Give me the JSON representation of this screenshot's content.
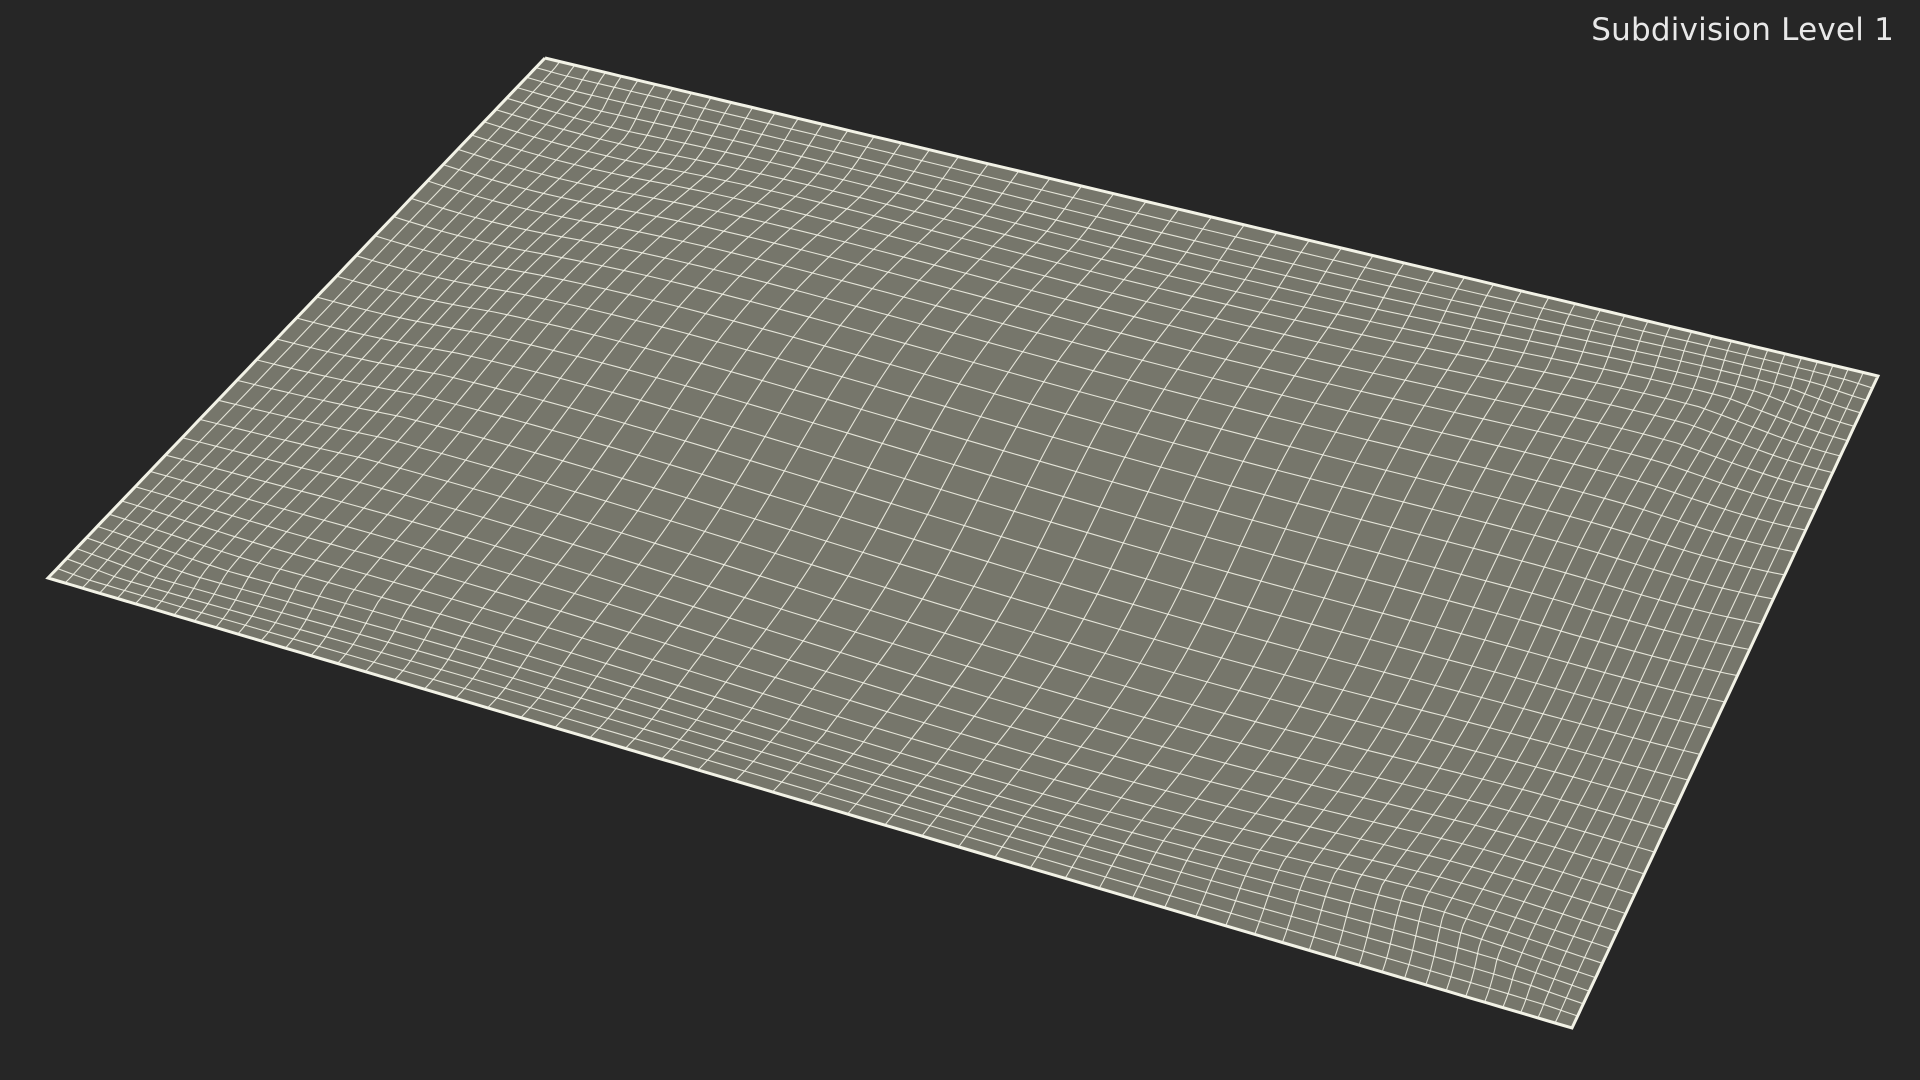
{
  "viewport": {
    "overlay_label": "Subdivision Level 1"
  },
  "scene": {
    "object": "wireframe-mesh",
    "background_color": "#262626",
    "surface_color": "#76766b",
    "wire_color": "#f2f2e6"
  }
}
